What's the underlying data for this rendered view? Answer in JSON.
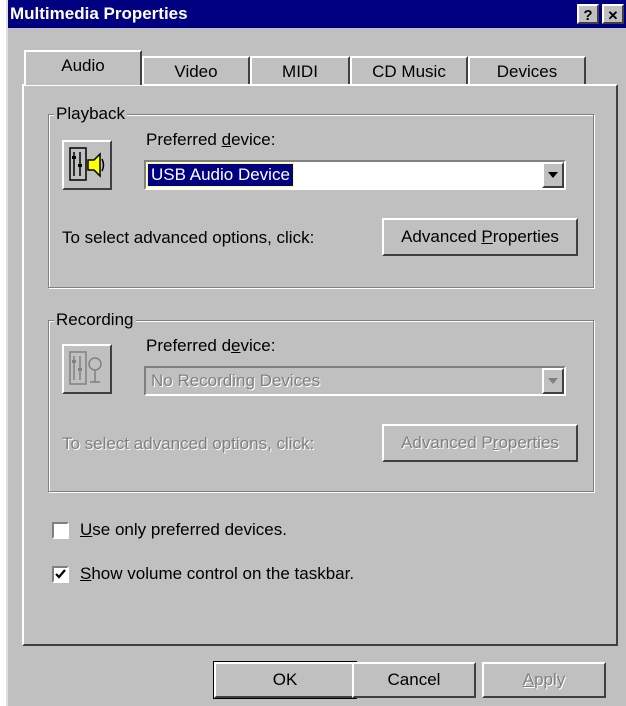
{
  "window": {
    "title": "Multimedia Properties",
    "help_glyph": "?",
    "close_glyph": "✕"
  },
  "tabs": [
    {
      "label": "Audio",
      "active": true
    },
    {
      "label": "Video",
      "active": false
    },
    {
      "label": "MIDI",
      "active": false
    },
    {
      "label": "CD Music",
      "active": false
    },
    {
      "label": "Devices",
      "active": false
    }
  ],
  "playback": {
    "group_label": "Playback",
    "icon": "speaker-icon",
    "preferred_pre": "Preferred ",
    "preferred_ul": "d",
    "preferred_post": "evice:",
    "device_value": "USB Audio Device",
    "advanced_text": "To select advanced options, click:",
    "advanced_btn_pre": "Advanced ",
    "advanced_btn_ul": "P",
    "advanced_btn_post": "roperties"
  },
  "recording": {
    "group_label": "Recording",
    "icon": "microphone-icon",
    "preferred_pre": "Preferred d",
    "preferred_ul": "e",
    "preferred_post": "vice:",
    "device_value": "No Recording Devices",
    "advanced_text": "To select advanced options, click:",
    "advanced_btn_pre": "Advanced P",
    "advanced_btn_ul": "r",
    "advanced_btn_post": "operties"
  },
  "options": {
    "use_preferred_ul": "U",
    "use_preferred_rest": "se only preferred devices.",
    "use_preferred_checked": false,
    "show_volume_ul": "S",
    "show_volume_rest": "how volume control on the taskbar.",
    "show_volume_checked": true
  },
  "buttons": {
    "ok": "OK",
    "cancel": "Cancel",
    "apply_ul": "A",
    "apply_rest": "pply"
  },
  "colors": {
    "titlebar": "#000080",
    "face": "#c0c0c0",
    "disabled_text": "#808080"
  }
}
